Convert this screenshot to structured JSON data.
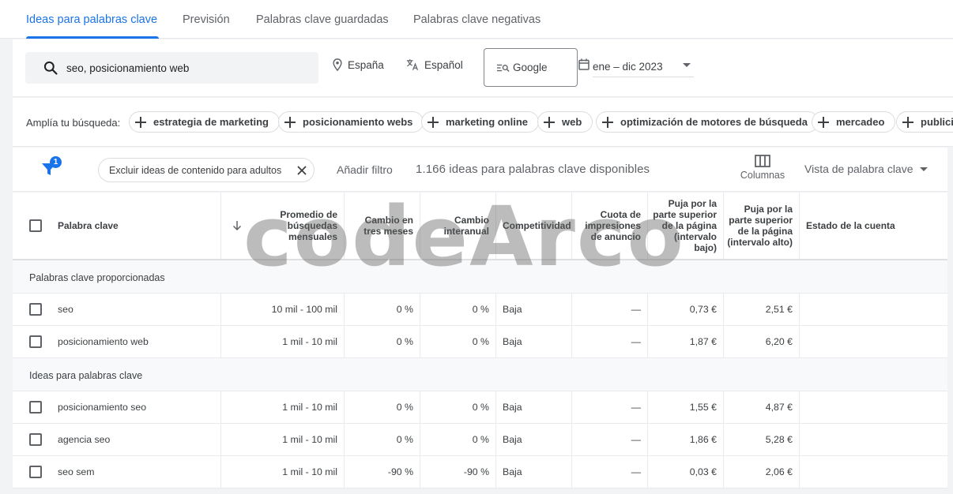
{
  "tabs": [
    {
      "label": "Ideas para palabras clave",
      "active": true
    },
    {
      "label": "Previsión",
      "active": false
    },
    {
      "label": "Palabras clave guardadas",
      "active": false
    },
    {
      "label": "Palabras clave negativas",
      "active": false
    }
  ],
  "search": {
    "query": "seo, posicionamiento web",
    "location": "España",
    "language": "Español",
    "engine": "Google",
    "date_range": "ene – dic 2023"
  },
  "broaden": {
    "label": "Amplía tu búsqueda:",
    "chips": [
      "estrategia de marketing",
      "posicionamiento webs",
      "marketing online",
      "web",
      "optimización de motores de búsqueda",
      "mercadeo",
      "publicid"
    ]
  },
  "filters": {
    "badge_count": "1",
    "exclude_chip": "Excluir ideas de contenido para adultos",
    "add_filter": "Añadir filtro",
    "ideas_count": "1.166 ideas para palabras clave disponibles",
    "columns_label": "Columnas",
    "view_label": "Vista de palabra clave"
  },
  "table": {
    "headers": {
      "keyword": "Palabra clave",
      "avg_searches": "Promedio de búsquedas mensuales",
      "three_month": "Cambio en tres meses",
      "yoy": "Cambio interanual",
      "competition": "Competitividad",
      "impression_share": "Cuota de impresiones de anuncio",
      "bid_low": "Puja por la parte superior de la página (intervalo bajo)",
      "bid_high": "Puja por la parte superior de la página (intervalo alto)",
      "account_status": "Estado de la cuenta"
    },
    "groups": [
      {
        "label": "Palabras clave proporcionadas",
        "rows": [
          {
            "keyword": "seo",
            "avg": "10 mil - 100 mil",
            "three": "0 %",
            "yoy": "0 %",
            "comp": "Baja",
            "share": "—",
            "low": "0,73 €",
            "high": "2,51 €"
          },
          {
            "keyword": "posicionamiento web",
            "avg": "1 mil - 10 mil",
            "three": "0 %",
            "yoy": "0 %",
            "comp": "Baja",
            "share": "—",
            "low": "1,87 €",
            "high": "6,20 €"
          }
        ]
      },
      {
        "label": "Ideas para palabras clave",
        "rows": [
          {
            "keyword": "posicionamiento seo",
            "avg": "1 mil - 10 mil",
            "three": "0 %",
            "yoy": "0 %",
            "comp": "Baja",
            "share": "—",
            "low": "1,55 €",
            "high": "4,87 €"
          },
          {
            "keyword": "agencia seo",
            "avg": "1 mil - 10 mil",
            "three": "0 %",
            "yoy": "0 %",
            "comp": "Baja",
            "share": "—",
            "low": "1,86 €",
            "high": "5,28 €"
          },
          {
            "keyword": "seo sem",
            "avg": "1 mil - 10 mil",
            "three": "-90 %",
            "yoy": "-90 %",
            "comp": "Baja",
            "share": "—",
            "low": "0,03 €",
            "high": "2,06 €"
          }
        ]
      }
    ]
  },
  "watermark": "codeArco",
  "colors": {
    "accent": "#1a73e8",
    "text": "#3c4043",
    "muted": "#5f6368",
    "background": "#f1f3f4"
  }
}
